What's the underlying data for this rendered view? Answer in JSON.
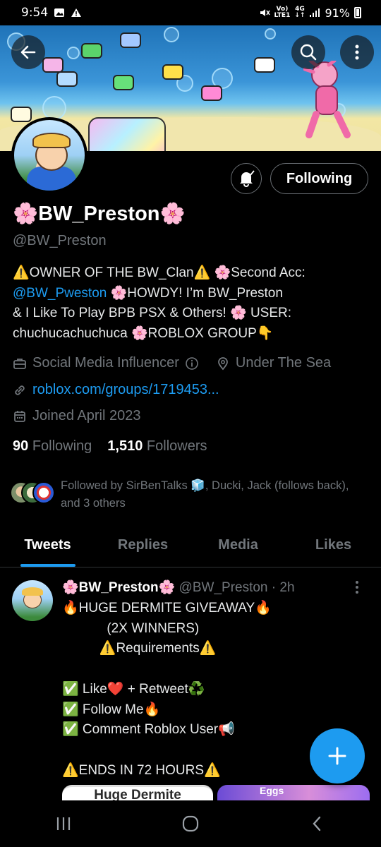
{
  "status_bar": {
    "time": "9:54",
    "net_top": "Vo)",
    "net_bottom": "LTE1",
    "net_type": "4G",
    "battery": "91%"
  },
  "profile": {
    "display_name": "🌸BW_Preston🌸",
    "handle": "@BW_Preston",
    "following_button": "Following",
    "bio_lines": [
      [
        "⚠️OWNER OF THE BW_Clan⚠️  🌸Second Acc:"
      ],
      [
        "@BW_Pweston",
        "  🌸HOWDY! I’m BW_Preston"
      ],
      [
        "& I Like To Play BPB PSX & Others!  🌸 USER:"
      ],
      [
        "chuchucachuchuca  🌸ROBLOX GROUP👇"
      ]
    ],
    "category": "Social Media Influencer",
    "location": "Under The Sea",
    "website": "roblox.com/groups/1719453...",
    "joined": "Joined April 2023",
    "following_count": "90",
    "following_label": "Following",
    "followers_count": "1,510",
    "followers_label": "Followers",
    "followed_by": "Followed by SirBenTalks 🧊, Ducki, Jack (follows back), and 3 others"
  },
  "tabs": [
    "Tweets",
    "Replies",
    "Media",
    "Likes"
  ],
  "tweet": {
    "name": "🌸BW_Preston🌸",
    "meta": " @BW_Preston · 2h",
    "body": "🔥HUGE DERMITE GIVEAWAY🔥\n            (2X WINNERS)\n          ⚠️Requirements⚠️\n\n✅ Like❤️ + Retweet♻️\n✅ Follow Me🔥\n✅ Comment Roblox User📢\n\n⚠️ENDS IN 72 HOURS⚠️",
    "media_left_text": "Huge Dermite",
    "media_right_text": "Eggs"
  },
  "colors": {
    "accent": "#1d9bf0",
    "background": "#000000",
    "muted": "#71767b"
  }
}
